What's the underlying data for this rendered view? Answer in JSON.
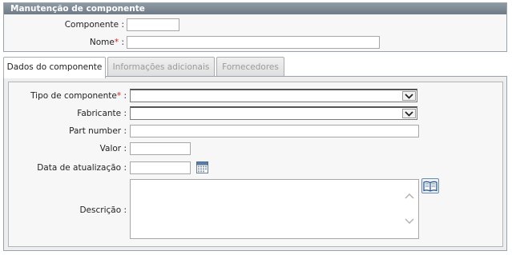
{
  "header": {
    "title": "Manutenção de componente"
  },
  "top_form": {
    "componente_label": "Componente :",
    "nome_label": "Nome",
    "nome_suffix": " :",
    "required_mark": "*",
    "componente_value": "",
    "nome_value": ""
  },
  "tabs": [
    {
      "label": "Dados do componente",
      "active": true
    },
    {
      "label": "Informações adicionais",
      "active": false
    },
    {
      "label": "Fornecedores",
      "active": false
    }
  ],
  "form": {
    "tipo_label": "Tipo de componente",
    "tipo_suffix": " :",
    "tipo_value": "",
    "fabricante_label": "Fabricante :",
    "fabricante_value": "",
    "part_number_label": "Part number :",
    "part_number_value": "",
    "valor_label": "Valor :",
    "valor_value": "",
    "data_label": "Data de atualização :",
    "data_value": "",
    "descricao_label": "Descrição :",
    "descricao_value": ""
  },
  "icons": {
    "calendar": "calendar-icon",
    "book": "book-icon",
    "dropdown": "chevron-down-icon"
  },
  "colors": {
    "header_bar": "#7a8792",
    "required": "#d42020",
    "panel_border": "#9aa3ab"
  }
}
